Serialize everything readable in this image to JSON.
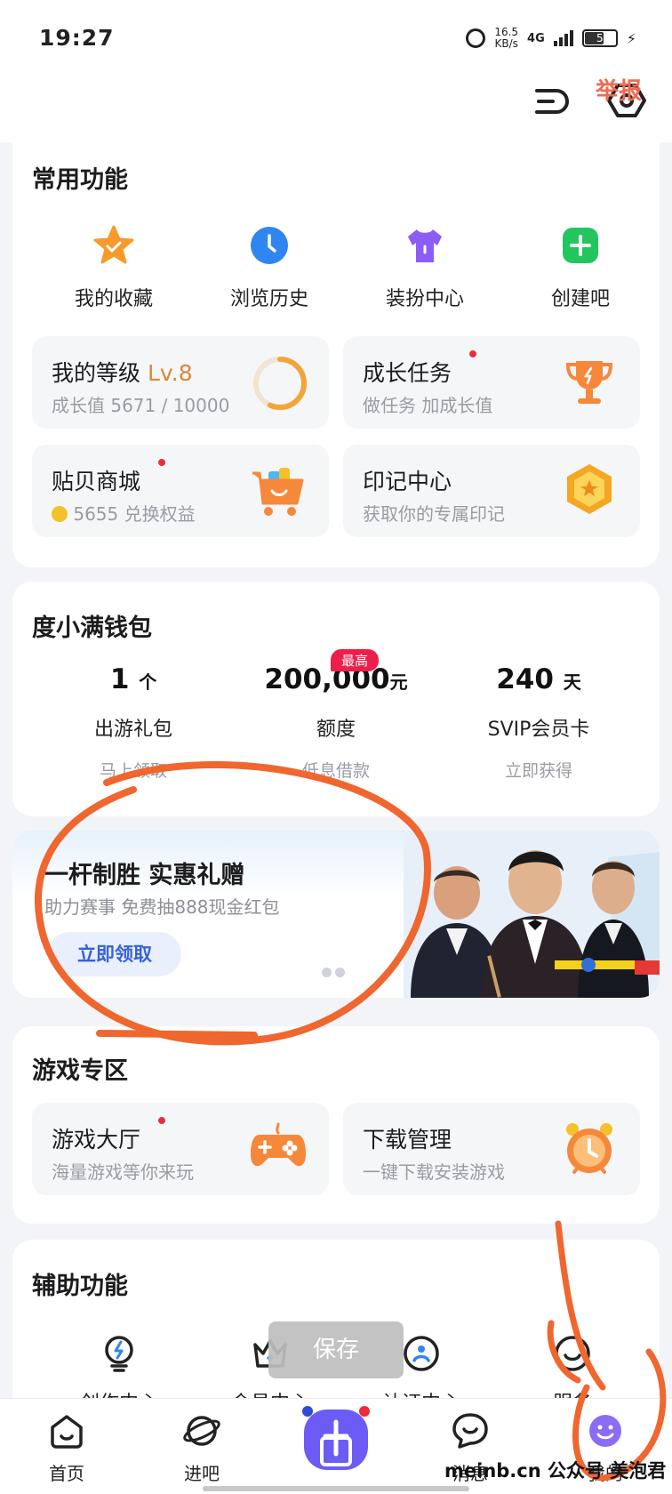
{
  "status_bar": {
    "time": "19:27",
    "speed_value": "16.5",
    "speed_unit": "KB/s",
    "network": "4G",
    "battery": "5"
  },
  "header": {
    "report_label": "举报"
  },
  "common": {
    "title": "常用功能",
    "items": [
      {
        "label": "我的收藏",
        "icon": "star-icon"
      },
      {
        "label": "浏览历史",
        "icon": "clock-icon"
      },
      {
        "label": "装扮中心",
        "icon": "shirt-icon"
      },
      {
        "label": "创建吧",
        "icon": "plus-icon"
      }
    ],
    "tiles": {
      "level": {
        "title": "我的等级",
        "level": "Lv.8",
        "sub": "成长值 5671 / 10000",
        "progress": 0.567
      },
      "growth": {
        "title": "成长任务",
        "sub": "做任务 加成长值"
      },
      "shop": {
        "title": "贴贝商城",
        "sub": "5655 兑换权益"
      },
      "mark": {
        "title": "印记中心",
        "sub": "获取你的专属印记"
      }
    }
  },
  "wallet": {
    "title": "度小满钱包",
    "badge": "最高",
    "items": [
      {
        "value": "1",
        "unit": "个",
        "name": "出游礼包",
        "sub": "马上领取"
      },
      {
        "value": "200,000",
        "unit": "元",
        "name": "额度",
        "sub": "低息借款"
      },
      {
        "value": "240",
        "unit": "天",
        "name": "SVIP会员卡",
        "sub": "立即获得"
      }
    ]
  },
  "banner": {
    "title": "一杆制胜 实惠礼赠",
    "subtitle": "助力赛事 免费抽888现金红包",
    "button": "立即领取"
  },
  "games": {
    "title": "游戏专区",
    "hall": {
      "title": "游戏大厅",
      "sub": "海量游戏等你来玩"
    },
    "download": {
      "title": "下载管理",
      "sub": "一键下载安装游戏"
    }
  },
  "aux": {
    "title": "辅助功能",
    "items": [
      {
        "label": "创作中心"
      },
      {
        "label": "会员中心"
      },
      {
        "label": "认证中心"
      },
      {
        "label": "服务"
      }
    ]
  },
  "toast": {
    "label": "保存"
  },
  "tabbar": {
    "items": [
      {
        "label": "首页"
      },
      {
        "label": "进吧"
      },
      {
        "label": "消息"
      },
      {
        "label": "我的"
      }
    ]
  },
  "watermark": "meinb.cn 公众号 美泡君",
  "colors": {
    "accent_red": "#ef2b3a",
    "wallet_badge": "#ee1e4a",
    "banner_button_text": "#3561d9",
    "annotation": "#f0662f"
  }
}
